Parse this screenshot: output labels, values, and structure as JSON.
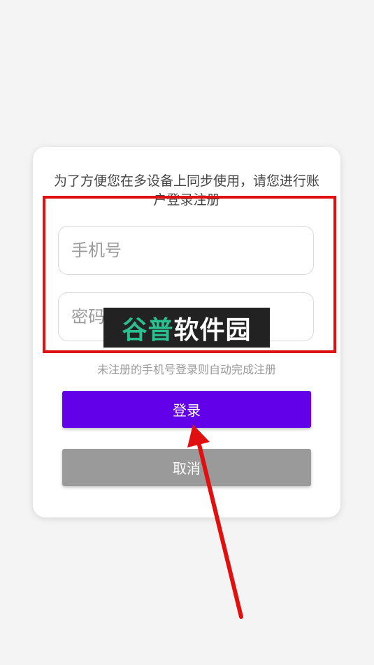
{
  "dialog": {
    "message": "为了方便您在多设备上同步使用，请您进行账户登录注册",
    "phone_placeholder": "手机号",
    "password_placeholder": "密码",
    "hint": "未注册的手机号登录则自动完成注册",
    "login_label": "登录",
    "cancel_label": "取消"
  },
  "watermark": {
    "part1": "谷普",
    "part2": "软件园"
  },
  "colors": {
    "primary": "#6200ea",
    "cancel": "#9a9a9a",
    "annotation": "#e11010",
    "watermark_green": "#2bbf8f"
  }
}
